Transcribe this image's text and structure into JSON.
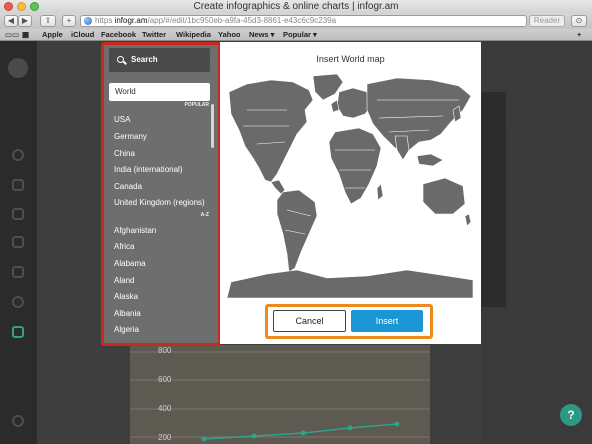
{
  "window": {
    "title": "Create infographics & online charts | infogr.am"
  },
  "toolbar": {
    "back_icon": "back-arrow-icon",
    "forward_icon": "forward-arrow-icon",
    "share_icon": "share-icon",
    "add_icon": "plus-icon",
    "url_scheme": "https",
    "url_host": "infogr.am",
    "url_path": "/app/#/edit/1bc950eb-a9fa-45d3-8861-e43c6c9c239a",
    "reader_label": "Reader",
    "download_icon": "download-icon"
  },
  "bookmarks": {
    "items": [
      "Apple",
      "iCloud",
      "Facebook",
      "Twitter",
      "Wikipedia",
      "Yahoo",
      "News ▾",
      "Popular ▾"
    ]
  },
  "modal": {
    "title": "Insert World map",
    "search_label": "Search",
    "selected_map": "World",
    "popular_label": "POPULAR",
    "popular": [
      "USA",
      "Germany",
      "China",
      "India (international)",
      "Canada",
      "United Kingdom (regions)"
    ],
    "az_label": "A-Z",
    "alphabetical": [
      "Afghanistan",
      "Africa",
      "Alabama",
      "Aland",
      "Alaska",
      "Albania",
      "Algeria"
    ],
    "cancel_label": "Cancel",
    "insert_label": "Insert"
  },
  "background": {
    "axis_labels": [
      "800",
      "600",
      "400",
      "200"
    ],
    "help_label": "?"
  },
  "colors": {
    "accent_insert": "#1a96d4",
    "highlight_red": "#c8281e",
    "highlight_orange": "#ec8a1f",
    "map_fill": "#6a6a6a"
  }
}
